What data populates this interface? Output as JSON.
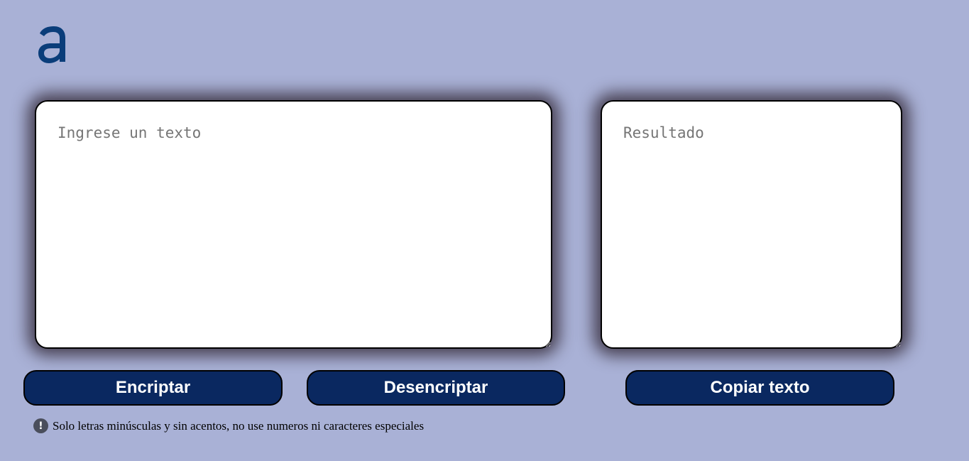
{
  "logo": {
    "icon": "alura-a-logo-icon",
    "color": "#0a3d7a"
  },
  "input": {
    "placeholder": "Ingrese un texto",
    "value": ""
  },
  "output": {
    "placeholder": "Resultado",
    "value": ""
  },
  "buttons": {
    "encrypt_label": "Encriptar",
    "decrypt_label": "Desencriptar",
    "copy_label": "Copiar texto"
  },
  "notice": {
    "icon": "exclamation-circle-icon",
    "icon_glyph": "!",
    "text": "Solo letras minúsculas y sin acentos, no use numeros ni caracteres especiales"
  },
  "colors": {
    "background": "#a9b1d6",
    "button": "#0a2860",
    "button_text": "#ffffff"
  }
}
